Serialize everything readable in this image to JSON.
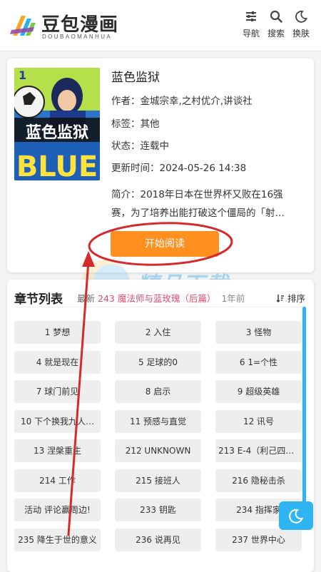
{
  "header": {
    "logo_title": "豆包漫画",
    "logo_sub": "DOUBAOMANHUA",
    "nav": [
      {
        "label": "导航",
        "icon": "sliders-icon"
      },
      {
        "label": "搜索",
        "icon": "search-icon"
      },
      {
        "label": "换肤",
        "icon": "moon-icon"
      }
    ]
  },
  "comic": {
    "cover_number": "1",
    "cover_title": "蓝色监狱",
    "title": "蓝色监狱",
    "author_label": "作者：",
    "author": "金城宗幸,之村优介,讲谈社",
    "tags_label": "标签：",
    "tags": "其他",
    "status_label": "状态：",
    "status": "连载中",
    "updated_label": "更新时间：",
    "updated": "2024-05-26 14:38",
    "intro_label": "简介：",
    "intro": "2018年日本在世界杯又败在16强赛，为了培养出能打破这个僵局的「射…",
    "start_button": "开始阅读"
  },
  "chapters": {
    "title": "章节列表",
    "latest_label": "最新",
    "latest_chapter": "243 魔法师与蓝玫瑰（后篇）",
    "latest_time": "1年前",
    "sort_label": "排序",
    "items": [
      "1 梦想",
      "2 入住",
      "3 怪物",
      "4 就是现在",
      "5 足球的0",
      "6 1=个性",
      "7 球门前见",
      "8 启示",
      "9 超级英雄",
      "10 下个换我九人…",
      "11 预感与直觉",
      "12 讯号",
      "13 涅槃重生",
      "212 UNKNOWN",
      "213 E-4（利己四人…",
      "214 工作",
      "215 接班人",
      "216 隐秘击杀",
      "活动 评论赢周边!",
      "233 钥匙",
      "234 指挥家",
      "235 降生于世的意义",
      "236 说再见",
      "237 世界中心"
    ]
  },
  "watermark": "精品下载",
  "colors": {
    "accent": "#ff8f1f",
    "scroll": "#2fb6f2",
    "latest_red": "#e74c6d",
    "annotation_red": "#d42a2a"
  }
}
